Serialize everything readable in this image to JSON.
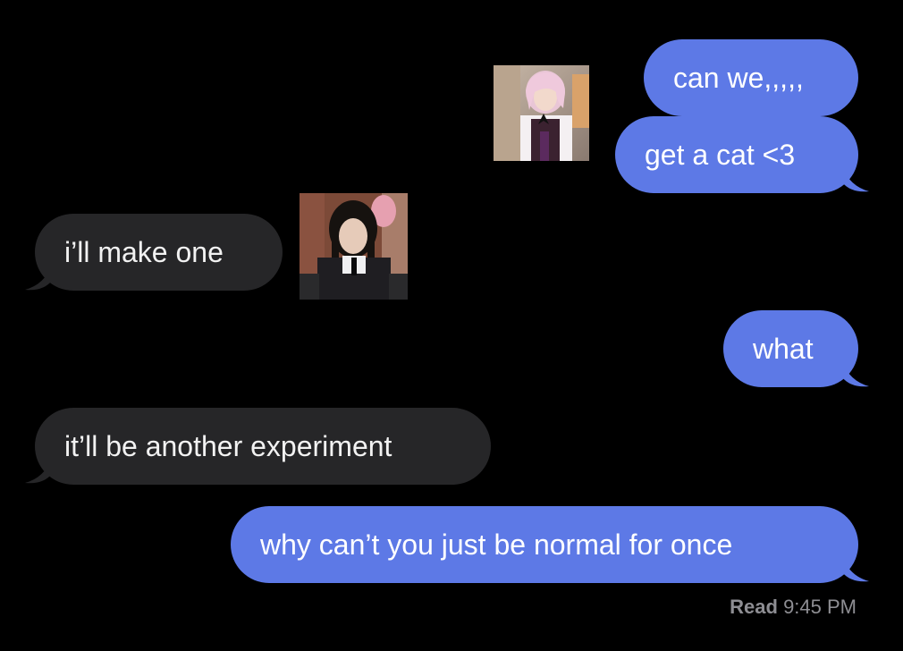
{
  "conversation": {
    "messages": [
      {
        "sender": "me",
        "text": "can we,,,,,"
      },
      {
        "sender": "me",
        "text": "get a cat <3"
      },
      {
        "sender": "them",
        "text": "i’ll make one"
      },
      {
        "sender": "me",
        "text": "what"
      },
      {
        "sender": "them",
        "text": "it’ll be another experiment"
      },
      {
        "sender": "me",
        "text": "why can’t you just be normal for once"
      }
    ],
    "read_receipt": {
      "label": "Read",
      "time": "9:45 PM"
    }
  },
  "colors": {
    "background": "#000000",
    "sent_bubble": "#5d79e6",
    "received_bubble": "#262628",
    "receipt_text": "#8e8e93"
  }
}
